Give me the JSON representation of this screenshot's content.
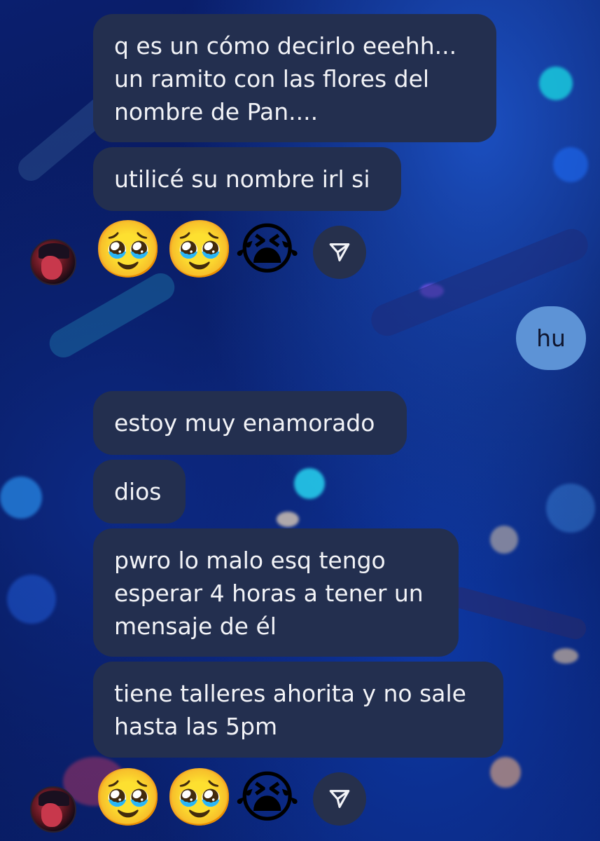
{
  "messages_block_1": [
    {
      "text": "q es un cómo decirlo eeehh...\nun ramito con las flores del\nnombre de Pan...."
    },
    {
      "text": "utilicé su nombre irl si"
    }
  ],
  "reactions_1": {
    "emojis": [
      "🥹",
      "🥹",
      "😭"
    ]
  },
  "outgoing_message": {
    "text": "hu"
  },
  "messages_block_2": [
    {
      "text": "estoy muy enamorado"
    },
    {
      "text": "dios"
    },
    {
      "text": "pwro lo malo esq tengo\nesperar 4 horas a tener un\nmensaje de él"
    },
    {
      "text": "tiene talleres ahorita y no sale\nhasta las 5pm"
    }
  ],
  "reactions_2": {
    "emojis": [
      "🥹",
      "🥹",
      "😭"
    ]
  },
  "colors": {
    "incoming_bubble": "#232f4f",
    "outgoing_bubble": "#5d93d6",
    "background": "#071a5c"
  },
  "icons": {
    "share": "send-arrow-icon",
    "avatar": "user-avatar"
  }
}
